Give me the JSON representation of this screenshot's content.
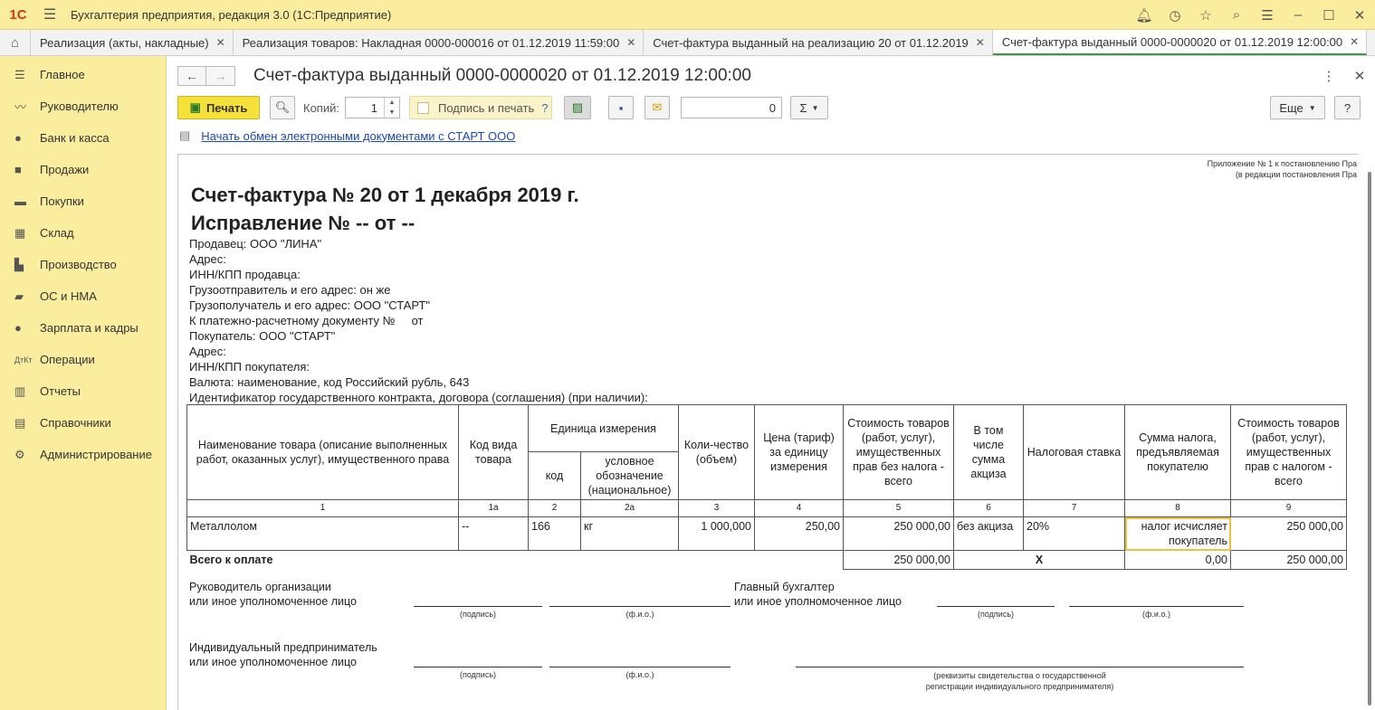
{
  "titlebar": {
    "logo": "1С",
    "title": "Бухгалтерия предприятия, редакция 3.0  (1С:Предприятие)"
  },
  "tabs": [
    {
      "label": "Реализация (акты, накладные)"
    },
    {
      "label": "Реализация товаров: Накладная 0000-000016 от 01.12.2019 11:59:00"
    },
    {
      "label": "Счет-фактура выданный на реализацию 20 от 01.12.2019"
    },
    {
      "label": "Счет-фактура выданный 0000-0000020 от 01.12.2019 12:00:00"
    }
  ],
  "sidebar": {
    "items": [
      {
        "label": "Главное",
        "icon": "menu-icon"
      },
      {
        "label": "Руководителю",
        "icon": "chart-icon"
      },
      {
        "label": "Банк и касса",
        "icon": "coin-icon"
      },
      {
        "label": "Продажи",
        "icon": "bag-icon"
      },
      {
        "label": "Покупки",
        "icon": "cart-icon"
      },
      {
        "label": "Склад",
        "icon": "grid-icon"
      },
      {
        "label": "Производство",
        "icon": "factory-icon"
      },
      {
        "label": "ОС и НМА",
        "icon": "truck-icon"
      },
      {
        "label": "Зарплата и кадры",
        "icon": "person-icon"
      },
      {
        "label": "Операции",
        "icon": "dt-kt-icon"
      },
      {
        "label": "Отчеты",
        "icon": "report-icon"
      },
      {
        "label": "Справочники",
        "icon": "book-icon"
      },
      {
        "label": "Администрирование",
        "icon": "gear-icon"
      }
    ]
  },
  "document": {
    "title": "Счет-фактура выданный 0000-0000020 от 01.12.2019 12:00:00",
    "toolbar": {
      "print_label": "Печать",
      "copies_label": "Копий:",
      "copies_value": "1",
      "sign_print_label": "Подпись и печать",
      "sign_help": "?",
      "sum_value": "0",
      "more_label": "Еще",
      "help_label": "?"
    },
    "edo_link": "Начать обмен электронными документами с СТАРТ ООО"
  },
  "invoice": {
    "appendix_line1": "Приложение № 1 к постановлению Пра",
    "appendix_line2": "(в редакции постановления Пра",
    "title": "Счет-фактура № 20 от 1 декабря 2019 г.",
    "correction": "Исправление № -- от --",
    "info_lines": [
      "Продавец: ООО \"ЛИНА\"",
      "Адрес:",
      "ИНН/КПП продавца:",
      "Грузоотправитель и его адрес: он же",
      "Грузополучатель и его адрес: ООО \"СТАРТ\"",
      "К платежно-расчетному документу №     от",
      "Покупатель: ООО \"СТАРТ\"",
      "Адрес:",
      "ИНН/КПП покупателя:",
      "Валюта: наименование, код Российский рубль, 643",
      "Идентификатор государственного контракта, договора (соглашения) (при наличии):"
    ],
    "headers": {
      "name": "Наименование товара (описание выполненных работ, оказанных услуг), имущественного права",
      "kind_code": "Код вида товара",
      "unit": "Единица измерения",
      "unit_code": "код",
      "unit_name": "условное обозначение (национальное)",
      "qty": "Коли-чество (объем)",
      "price": "Цена (тариф) за единицу измерения",
      "cost_no_tax": "Стоимость товаров (работ, услуг), имущественных прав без налога - всего",
      "excise": "В том числе сумма акциза",
      "tax_rate": "Налоговая ставка",
      "tax_sum": "Сумма налога, предъявляемая покупателю",
      "cost_with_tax": "Стоимость товаров (работ, услуг), имущественных прав с налогом - всего"
    },
    "col_numbers": [
      "1",
      "1а",
      "2",
      "2а",
      "3",
      "4",
      "5",
      "6",
      "7",
      "8",
      "9"
    ],
    "row": {
      "name": "Металлолом",
      "kind_code": "--",
      "unit_code": "166",
      "unit_name": "кг",
      "qty": "1 000,000",
      "price": "250,00",
      "cost_no_tax": "250 000,00",
      "excise": "без акциза",
      "tax_rate": "20%",
      "tax_sum": "налог исчисляет покупатель",
      "cost_with_tax": "250 000,00"
    },
    "total": {
      "label": "Всего к оплате",
      "cost_no_tax": "250 000,00",
      "x": "X",
      "tax_sum": "0,00",
      "cost_with_tax": "250 000,00"
    },
    "signatures": {
      "head_line1": "Руководитель организации",
      "head_line2": "или иное уполномоченное лицо",
      "acc_line1": "Главный бухгалтер",
      "acc_line2": "или иное уполномоченное лицо",
      "ip_line1": "Индивидуальный предприниматель",
      "ip_line2": "или иное уполномоченное лицо",
      "sign_cap": "(подпись)",
      "fio_cap": "(ф.и.о.)",
      "req_cap1": "(реквизиты свидетельства о государственной",
      "req_cap2": "регистрации индивидуального предпринимателя)"
    }
  }
}
